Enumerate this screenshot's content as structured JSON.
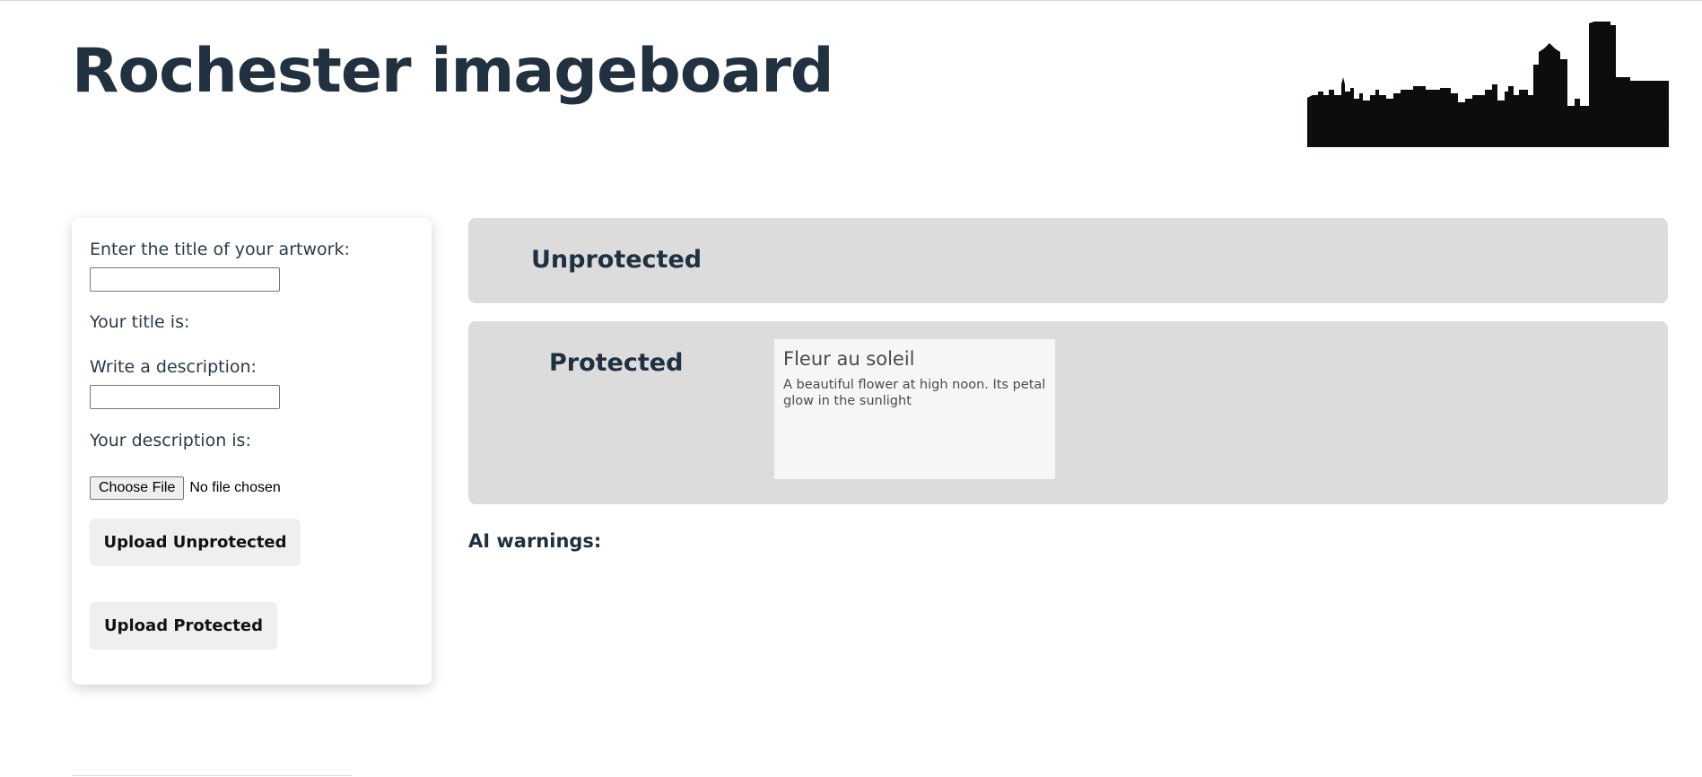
{
  "header": {
    "title": "Rochester imageboard"
  },
  "upload_form": {
    "title_label": "Enter the title of your artwork:",
    "title_value": "",
    "title_echo": "Your title is:",
    "description_label": "Write a description:",
    "description_value": "",
    "description_echo": "Your description is:",
    "file_button": "Choose File",
    "file_status": "No file chosen",
    "upload_unprotected": "Upload Unprotected",
    "upload_protected": "Upload Protected"
  },
  "panels": {
    "unprotected": {
      "title": "Unprotected",
      "items": []
    },
    "protected": {
      "title": "Protected",
      "items": [
        {
          "title": "Fleur au soleil",
          "description": "A beautiful flower at high noon. Its petal glow in the sunlight"
        }
      ]
    }
  },
  "ai_warnings": {
    "label": "AI warnings:"
  },
  "colors": {
    "heading": "#22313f",
    "panel_bg": "#dcdcdc",
    "card_bg": "#f6f6f6",
    "button_bg": "#efefef",
    "skyline": "#0b0e0d"
  },
  "icons": {
    "logo": "rochester-skyline-logo"
  }
}
